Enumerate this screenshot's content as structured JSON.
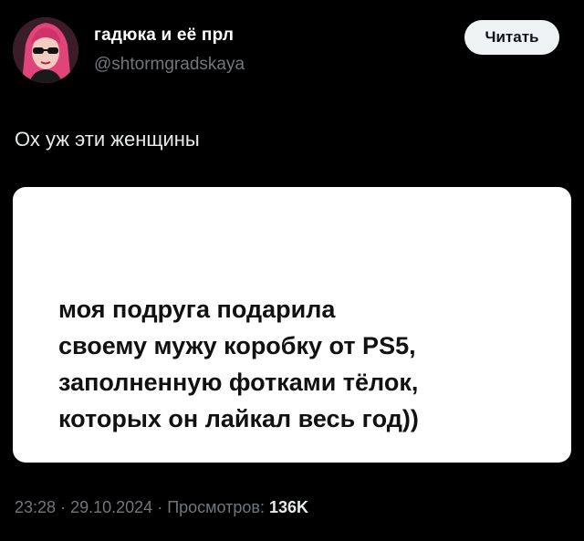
{
  "author": {
    "display_name": "гадюка и её прл",
    "handle": "@shtormgradskaya",
    "avatar_icon": "user-avatar-photo"
  },
  "follow_button": {
    "label": "Читать"
  },
  "tweet": {
    "text": "Ох уж эти женщины",
    "media_text": "моя подруга подарила\nсвоему мужу коробку от PS5,\nзаполненную фотками тёлок,\nкоторых он лайкал весь год))"
  },
  "meta": {
    "time": "23:28",
    "date": "29.10.2024",
    "views_label": "Просмотров:",
    "views_count": "136K",
    "separator": "·"
  },
  "colors": {
    "background": "#000000",
    "text_primary": "#e7e9ea",
    "text_secondary": "#71767b",
    "button_bg": "#eff3f4",
    "card_bg": "#ffffff"
  }
}
